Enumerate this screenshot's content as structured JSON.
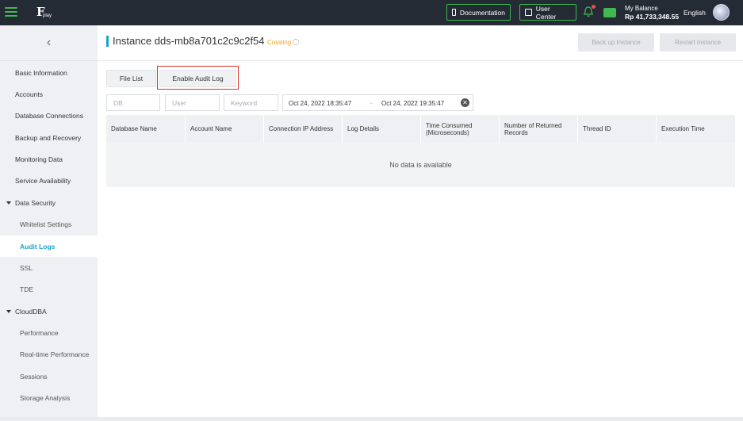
{
  "topbar": {
    "documentation_label": "Documentation",
    "user_center_label": "User Center",
    "balance_label": "My Balance",
    "balance_value": "Rp 41,733,348.55",
    "language": "English",
    "logo_sub": "play"
  },
  "sidebar": {
    "back_glyph": "‹",
    "items": [
      {
        "label": "Basic Information"
      },
      {
        "label": "Accounts"
      },
      {
        "label": "Database Connections"
      },
      {
        "label": "Backup and Recovery"
      },
      {
        "label": "Monitoring Data"
      },
      {
        "label": "Service Availability"
      },
      {
        "label": "Data Security"
      },
      {
        "label": "Whitelist Settings"
      },
      {
        "label": "Audit Logs"
      },
      {
        "label": "SSL"
      },
      {
        "label": "TDE"
      },
      {
        "label": "CloudDBA"
      },
      {
        "label": "Performance"
      },
      {
        "label": "Real-time Performance"
      },
      {
        "label": "Sessions"
      },
      {
        "label": "Storage Analysis"
      }
    ],
    "active": "Audit Logs"
  },
  "header": {
    "title": "Instance dds-mb8a701c2c9c2f54",
    "status": "Creating",
    "backup_button": "Back up Instance",
    "restart_button": "Restart Instance"
  },
  "tabs": {
    "file_list": "File List",
    "enable_audit_log": "Enable Audit Log"
  },
  "filters": {
    "db_placeholder": "DB",
    "user_placeholder": "User",
    "keyword_placeholder": "Keyword",
    "start_time": "Oct 24, 2022 18:35:47",
    "separator": "-",
    "end_time": "Oct 24, 2022 19:35:47",
    "clear_glyph": "✕"
  },
  "table": {
    "columns": [
      "Database Name",
      "Account Name",
      "Connection IP Address",
      "Log Details",
      "Time Consumed (Microseconds)",
      "Number of Returned Records",
      "Thread ID",
      "Execution Time"
    ],
    "empty_text": "No data is available"
  },
  "colors": {
    "accent": "#1aa3c7",
    "topbar": "#242b35",
    "green": "#3fb950",
    "status_creating": "#f5a623",
    "highlight_border": "#d9322b"
  }
}
